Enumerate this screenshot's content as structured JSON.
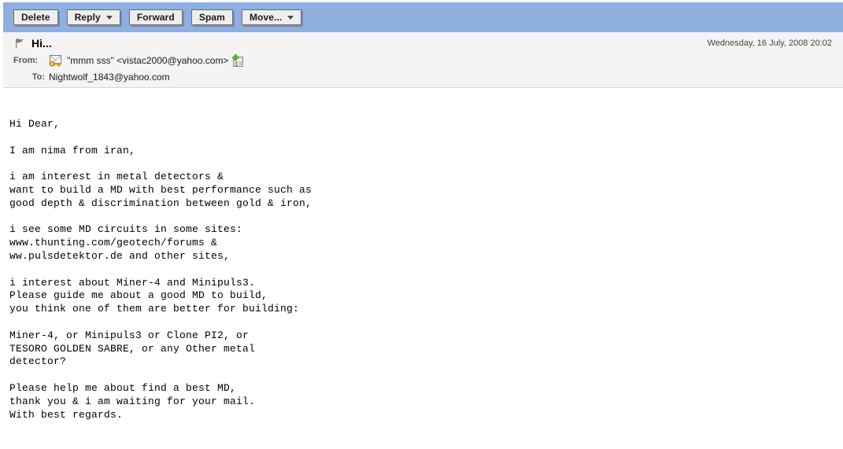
{
  "toolbar": {
    "buttons": [
      {
        "label": "Delete",
        "name": "delete-button",
        "dropdown": false
      },
      {
        "label": "Reply",
        "name": "reply-button",
        "dropdown": true
      },
      {
        "label": "Forward",
        "name": "forward-button",
        "dropdown": false
      },
      {
        "label": "Spam",
        "name": "spam-button",
        "dropdown": false
      },
      {
        "label": "Move...",
        "name": "move-button",
        "dropdown": true
      }
    ],
    "delete_label": "Delete",
    "reply_label": "Reply",
    "forward_label": "Forward",
    "spam_label": "Spam",
    "move_label": "Move..."
  },
  "message": {
    "subject": "Hi...",
    "date": "Wednesday, 16 July, 2008 20:02",
    "from_label": "From:",
    "from_value": "\"mmm sss\" <vistac2000@yahoo.com>",
    "to_label": "To:",
    "to_value": "Nightwolf_1843@yahoo.com",
    "flag_icon": "flag-icon",
    "sender_icon": "envelope-key-icon",
    "add_contact_icon": "add-contact-icon",
    "body": "Hi Dear,\n\nI am nima from iran,\n\ni am interest in metal detectors &\nwant to build a MD with best performance such as\ngood depth & discrimination between gold & iron,\n\ni see some MD circuits in some sites:\nwww.thunting.com/geotech/forums &\nww.pulsdetektor.de and other sites,\n\ni interest about Miner-4 and Minipuls3.\nPlease guide me about a good MD to build,\nyou think one of them are better for building:\n\nMiner-4, or Minipuls3 or Clone PI2, or\nTESORO GOLDEN SABRE, or any Other metal\ndetector?\n\nPlease help me about find a best MD,\nthank you & i am waiting for your mail.\nWith best regards."
  },
  "colors": {
    "toolbar_bg": "#8eafdf",
    "header_bg": "#f4f4f4",
    "button_face": "#eeeeee",
    "body_bg": "#ffffff",
    "label_text": "#555555"
  }
}
